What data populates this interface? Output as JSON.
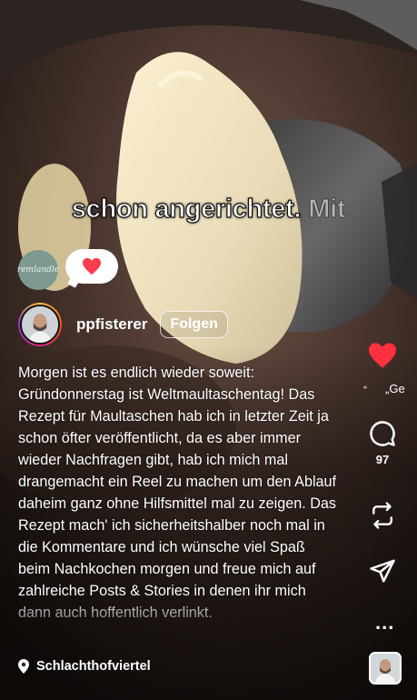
{
  "reel": {
    "overlay_caption": {
      "main": "schon angerichtet.",
      "faded": "Mit"
    },
    "sticker_text": "remlandle",
    "reaction_bubble_icon": "heart-icon",
    "author": {
      "username": "ppfisterer",
      "follow_label": "Folgen",
      "avatar_icon": "profile-avatar"
    },
    "description": "Morgen ist es endlich wieder soweit: Gründonnerstag ist Weltmaultaschentag! Das Rezept für Maultaschen hab ich in letzter Zeit ja schon öfter veröffentlicht, da es aber immer wieder Nachfragen gibt, hab ich mich mal drangemacht ein Reel zu machen um den Ablauf daheim ganz ohne Hilfsmittel mal zu zeigen. Das Rezept mach' ich sicherheitshalber noch mal in die Kommentare und ich wünsche viel Spaß beim Nachkochen morgen und freue mich auf zahlreiche Posts & Stories in denen ihr mich dann auch hoffentlich verlinkt.",
    "location": {
      "icon": "location-pin-icon",
      "label": "Schlachthofviertel"
    }
  },
  "actions": {
    "like": {
      "icon": "heart-icon",
      "color": "#ff3040",
      "liked": true
    },
    "liked_by_quote_open": "“",
    "liked_by_preview": "„Ge",
    "comments": {
      "icon": "comment-icon",
      "count": "97"
    },
    "repost": {
      "icon": "repost-icon"
    },
    "share": {
      "icon": "send-icon"
    },
    "more": {
      "icon": "more-icon",
      "label": "..."
    },
    "audio": {
      "icon": "audio-thumbnail"
    }
  }
}
